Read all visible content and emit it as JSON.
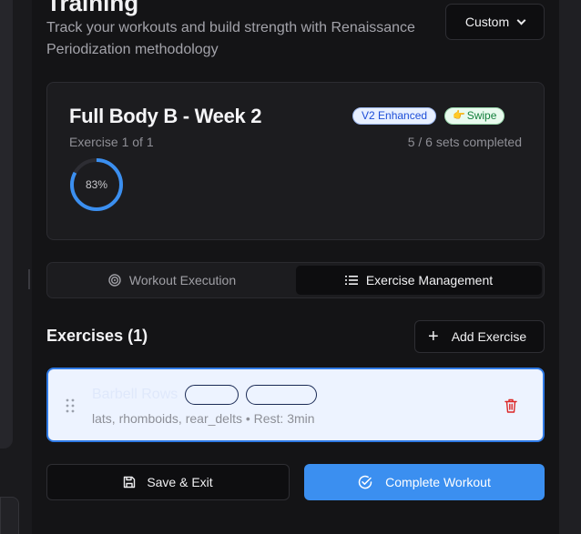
{
  "header": {
    "title": "Training",
    "subtitle": "Track your workouts and build strength with Renaissance Periodization methodology",
    "mode_select": "Custom"
  },
  "workout": {
    "name": "Full Body B - Week 2",
    "badges": {
      "v2": "V2 Enhanced",
      "swipe": "Swipe"
    },
    "exercise_progress": "Exercise 1 of 1",
    "sets_progress": "5 / 6 sets completed",
    "percent_label": "83%",
    "percent_value": 0.83
  },
  "tabs": [
    {
      "label": "Workout Execution",
      "icon": "target-icon",
      "active": false
    },
    {
      "label": "Exercise Management",
      "icon": "list-icon",
      "active": true
    }
  ],
  "exercises": {
    "heading": "Exercises (1)",
    "add_label": "Add Exercise",
    "items": [
      {
        "name": "Barbell Rows",
        "details": "lats, rhomboids, rear_delts • Rest: 3min"
      }
    ]
  },
  "actions": {
    "save_label": "Save & Exit",
    "complete_label": "Complete Workout"
  },
  "colors": {
    "accent": "#3b8ff0",
    "selected_card_bg": "#edf3ff",
    "delete": "#dc2626"
  }
}
